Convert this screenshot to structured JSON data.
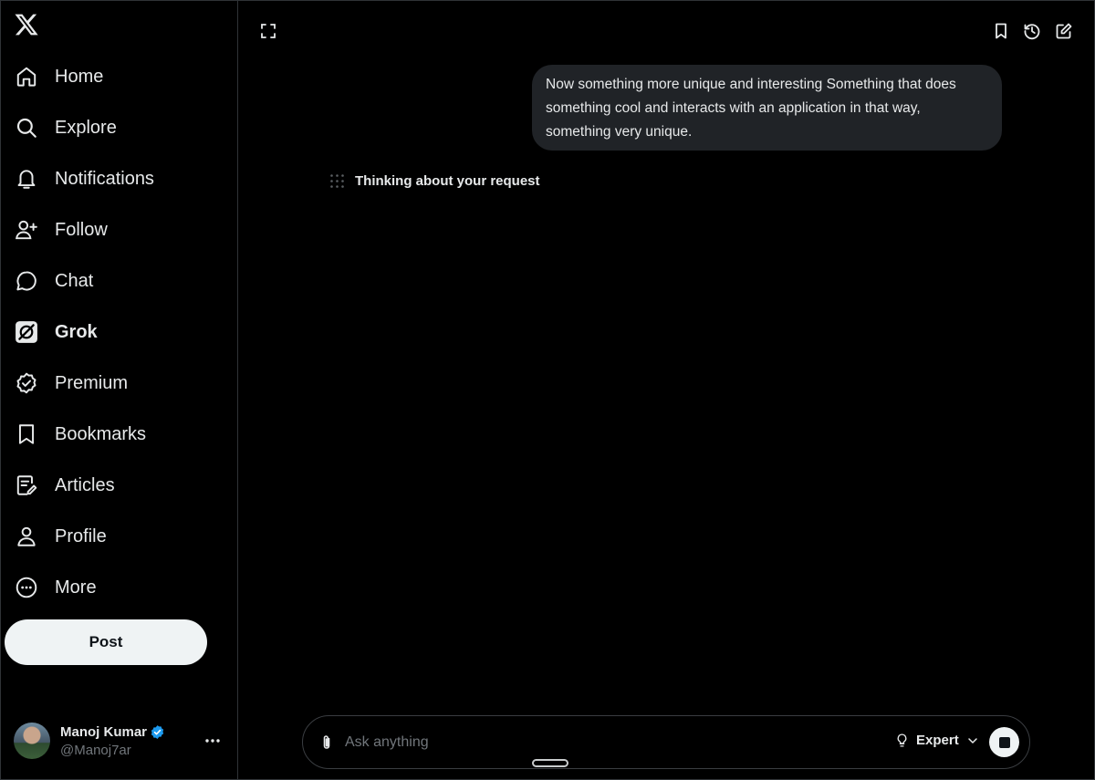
{
  "sidebar": {
    "logo_icon": "x-logo-icon",
    "items": [
      {
        "label": "Home",
        "icon": "home-icon"
      },
      {
        "label": "Explore",
        "icon": "search-icon"
      },
      {
        "label": "Notifications",
        "icon": "bell-icon"
      },
      {
        "label": "Follow",
        "icon": "person-plus-icon"
      },
      {
        "label": "Chat",
        "icon": "chat-bubble-icon"
      },
      {
        "label": "Grok",
        "icon": "grok-icon",
        "active": true
      },
      {
        "label": "Premium",
        "icon": "verified-badge-icon"
      },
      {
        "label": "Bookmarks",
        "icon": "bookmark-icon"
      },
      {
        "label": "Articles",
        "icon": "article-icon"
      },
      {
        "label": "Profile",
        "icon": "person-icon"
      },
      {
        "label": "More",
        "icon": "more-circle-icon"
      }
    ],
    "post_label": "Post",
    "account": {
      "name": "Manoj Kumar",
      "handle": "@Manoj7ar",
      "verified": true
    }
  },
  "topbar": {
    "left_icon": "expand-icon",
    "right_icons": [
      "bookmark-icon",
      "history-icon",
      "new-chat-icon"
    ]
  },
  "conversation": {
    "user_message": "Now something more unique and interesting Something that does something cool and interacts with an application in that way, something very unique.",
    "status_text": "Thinking about your request"
  },
  "composer": {
    "placeholder": "Ask anything",
    "value": "",
    "mode_label": "Expert",
    "attach_icon": "paperclip-icon",
    "stop_icon": "stop-icon"
  },
  "colors": {
    "background": "#000000",
    "text": "#e7e9ea",
    "muted": "#71767b",
    "bubble": "#202327",
    "verified_blue": "#1d9bf0",
    "button_light": "#eff3f4"
  }
}
